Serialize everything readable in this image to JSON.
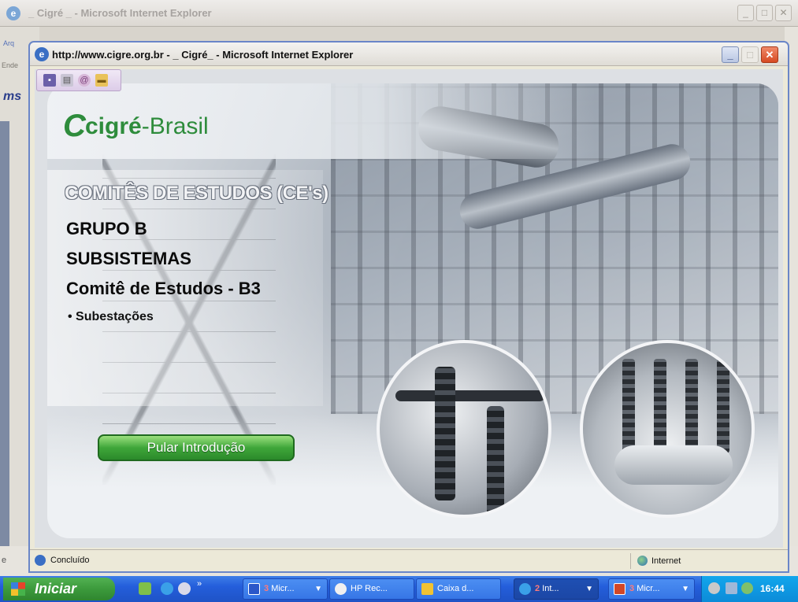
{
  "back_window": {
    "title": "_ Cigré _ - Microsoft Internet Explorer",
    "side_fragment_1": "Arq",
    "side_fragment_2": "Ende",
    "side_fragment_3": "ms"
  },
  "popup": {
    "title": "http://www.cigre.org.br - _ Cigré_ - Microsoft Internet Explorer",
    "toolbar_icons": [
      "save-icon",
      "print-icon",
      "mail-icon",
      "folder-icon"
    ],
    "logo": {
      "mark": "C",
      "text_bold": "cigré",
      "text_rest": "-Brasil"
    },
    "heading": "COMITÊS DE ESTUDOS (CE's)",
    "group": "GRUPO B",
    "subtitle": "SUBSISTEMAS",
    "committee": "Comitê de Estudos - B3",
    "bullet": "• Subestações",
    "skip_button": "Pular Introdução",
    "status_text": "Concluído",
    "zone_text": "Internet"
  },
  "taskbar": {
    "start_label": "Iniciar",
    "buttons": [
      {
        "num": "3",
        "label": "Micr..."
      },
      {
        "num": "",
        "label": "HP Rec..."
      },
      {
        "num": "",
        "label": "Caixa d..."
      },
      {
        "num": "2",
        "label": "Int..."
      },
      {
        "num": "3",
        "label": "Micr..."
      }
    ],
    "clock": "16:44"
  },
  "colors": {
    "brand_green": "#2e8c3c",
    "taskbar_blue": "#245edb",
    "close_red": "#d64a22"
  }
}
